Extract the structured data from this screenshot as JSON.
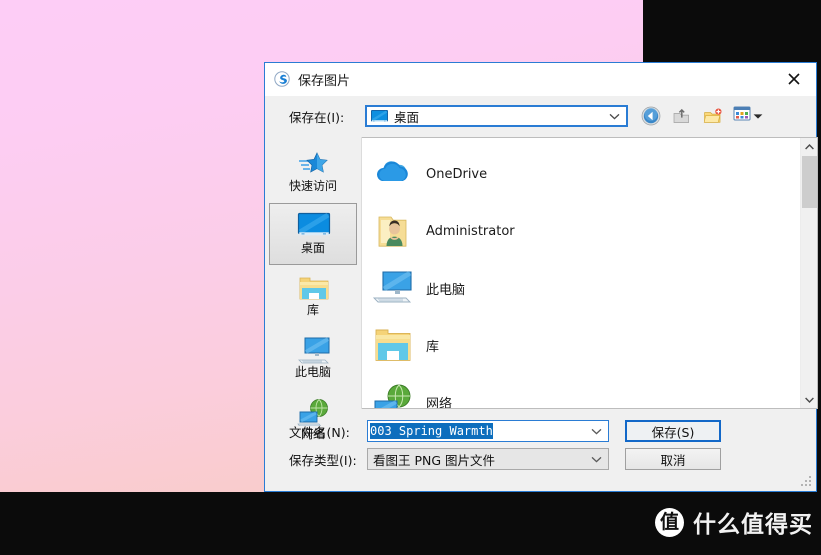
{
  "desktop": {
    "background_top_color": "#fdcdf6",
    "background_bottom_color": "#f8cbc7",
    "black_color": "#0b0b0b"
  },
  "watermark": {
    "badge_text": "值",
    "text": "什么值得买"
  },
  "dialog": {
    "title": "保存图片",
    "app_icon": "blue-swirl-icon",
    "close_label": "×",
    "lookin": {
      "label": "保存在(I):",
      "value": "桌面",
      "icon": "desktop-monitor-icon"
    },
    "toolbar": [
      {
        "name": "back-button",
        "icon": "back-arrow-icon"
      },
      {
        "name": "up-folder-button",
        "icon": "up-folder-icon"
      },
      {
        "name": "new-folder-button",
        "icon": "new-folder-icon"
      },
      {
        "name": "views-button",
        "icon": "views-grid-icon"
      }
    ],
    "places": [
      {
        "label": "快速访问",
        "icon": "quick-access-star-icon",
        "selected": false
      },
      {
        "label": "桌面",
        "icon": "desktop-monitor-icon",
        "selected": true
      },
      {
        "label": "库",
        "icon": "library-folder-icon",
        "selected": false
      },
      {
        "label": "此电脑",
        "icon": "this-pc-icon",
        "selected": false
      },
      {
        "label": "网络",
        "icon": "network-globe-icon",
        "selected": false
      }
    ],
    "files": [
      {
        "label": "OneDrive",
        "icon": "onedrive-cloud-icon"
      },
      {
        "label": "Administrator",
        "icon": "user-folder-icon"
      },
      {
        "label": "此电脑",
        "icon": "this-pc-icon"
      },
      {
        "label": "库",
        "icon": "library-folder-icon"
      },
      {
        "label": "网络",
        "icon": "network-globe-icon"
      }
    ],
    "form": {
      "filename_label": "文件名(N):",
      "filename_value": "003 Spring Warmth",
      "filetype_label": "保存类型(I):",
      "filetype_value": "看图王 PNG 图片文件",
      "save_label": "保存(S)",
      "cancel_label": "取消"
    }
  }
}
